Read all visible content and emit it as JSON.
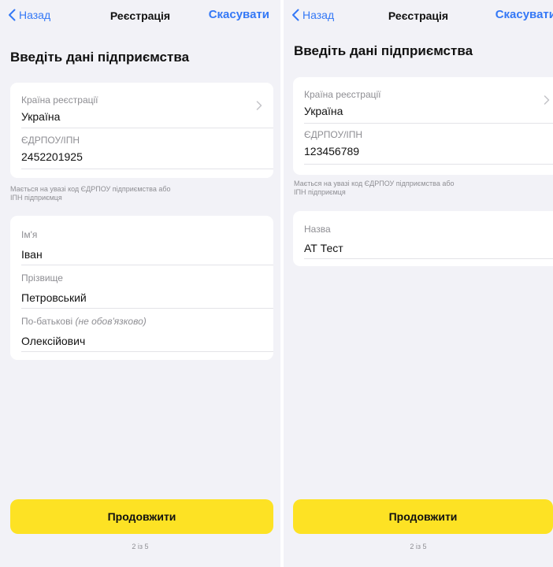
{
  "nav": {
    "back_label": "Назад",
    "title": "Реєстрація",
    "cancel_label": "Скасувати"
  },
  "heading": "Введіть дані підприємства",
  "left_screen": {
    "country_label": "Країна реєстрації",
    "country_value": "Україна",
    "edrpou_label": "ЄДРПОУ/ІПН",
    "edrpou_value": "2452201925",
    "hint_line1": "Мається на увазі код ЄДРПОУ підприємства або",
    "hint_line2": "ІПН підприємця",
    "first_name_label": "Ім'я",
    "first_name_value": "Іван",
    "last_name_label": "Прізвище",
    "last_name_value": "Петровський",
    "patronymic_label": "По-батькові",
    "patronymic_optional": "(не обов'язково)",
    "patronymic_value": "Олексійович"
  },
  "right_screen": {
    "country_label": "Країна реєстрації",
    "country_value": "Україна",
    "edrpou_label": "ЄДРПОУ/ІПН",
    "edrpou_value": "123456789",
    "hint_line1": "Мається на увазі код ЄДРПОУ підприємства або",
    "hint_line2": "ІПН підприємця",
    "name_label": "Назва",
    "name_value": "АТ Тест"
  },
  "continue_label": "Продовжити",
  "pager_text": "2 із 5",
  "colors": {
    "accent_blue": "#3478f6",
    "button_yellow": "#fde224",
    "background": "#f2f2f7"
  }
}
